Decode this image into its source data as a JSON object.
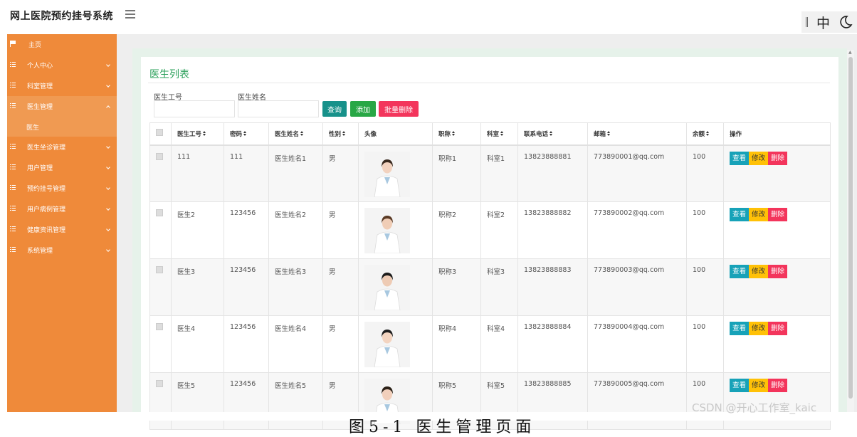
{
  "app": {
    "title": "网上医院预约挂号系统"
  },
  "header": {
    "lang_label": "中"
  },
  "sidebar": {
    "items": [
      {
        "label": "主页"
      },
      {
        "label": "个人中心"
      },
      {
        "label": "科室管理"
      },
      {
        "label": "医生管理",
        "sub": [
          "医生"
        ]
      },
      {
        "label": "医生坐诊管理"
      },
      {
        "label": "用户管理"
      },
      {
        "label": "预约挂号管理"
      },
      {
        "label": "用户病例管理"
      },
      {
        "label": "健康资讯管理"
      },
      {
        "label": "系统管理"
      }
    ]
  },
  "panel": {
    "title": "医生列表",
    "search": {
      "id_label": "医生工号",
      "name_label": "医生姓名",
      "query_btn": "查询",
      "add_btn": "添加",
      "batch_delete_btn": "批量删除"
    }
  },
  "table": {
    "headers": [
      "医生工号",
      "密码",
      "医生姓名",
      "性别",
      "头像",
      "职称",
      "科室",
      "联系电话",
      "邮箱",
      "余额",
      "操作"
    ],
    "actions": {
      "view": "查看",
      "edit": "修改",
      "delete": "删除"
    },
    "rows": [
      {
        "id": "111",
        "password": "111",
        "name": "医生姓名1",
        "gender": "男",
        "title": "职称1",
        "dept": "科室1",
        "phone": "13823888881",
        "email": "773890001@qq.com",
        "balance": "100"
      },
      {
        "id": "医生2",
        "password": "123456",
        "name": "医生姓名2",
        "gender": "男",
        "title": "职称2",
        "dept": "科室2",
        "phone": "13823888882",
        "email": "773890002@qq.com",
        "balance": "100"
      },
      {
        "id": "医生3",
        "password": "123456",
        "name": "医生姓名3",
        "gender": "男",
        "title": "职称3",
        "dept": "科室3",
        "phone": "13823888883",
        "email": "773890003@qq.com",
        "balance": "100"
      },
      {
        "id": "医生4",
        "password": "123456",
        "name": "医生姓名4",
        "gender": "男",
        "title": "职称4",
        "dept": "科室4",
        "phone": "13823888884",
        "email": "773890004@qq.com",
        "balance": "100"
      },
      {
        "id": "医生5",
        "password": "123456",
        "name": "医生姓名5",
        "gender": "男",
        "title": "职称5",
        "dept": "科室5",
        "phone": "13823888885",
        "email": "773890005@qq.com",
        "balance": "100"
      }
    ]
  },
  "caption": "图5-1 医生管理页面",
  "watermark": "CSDN @开心工作室_kaic"
}
